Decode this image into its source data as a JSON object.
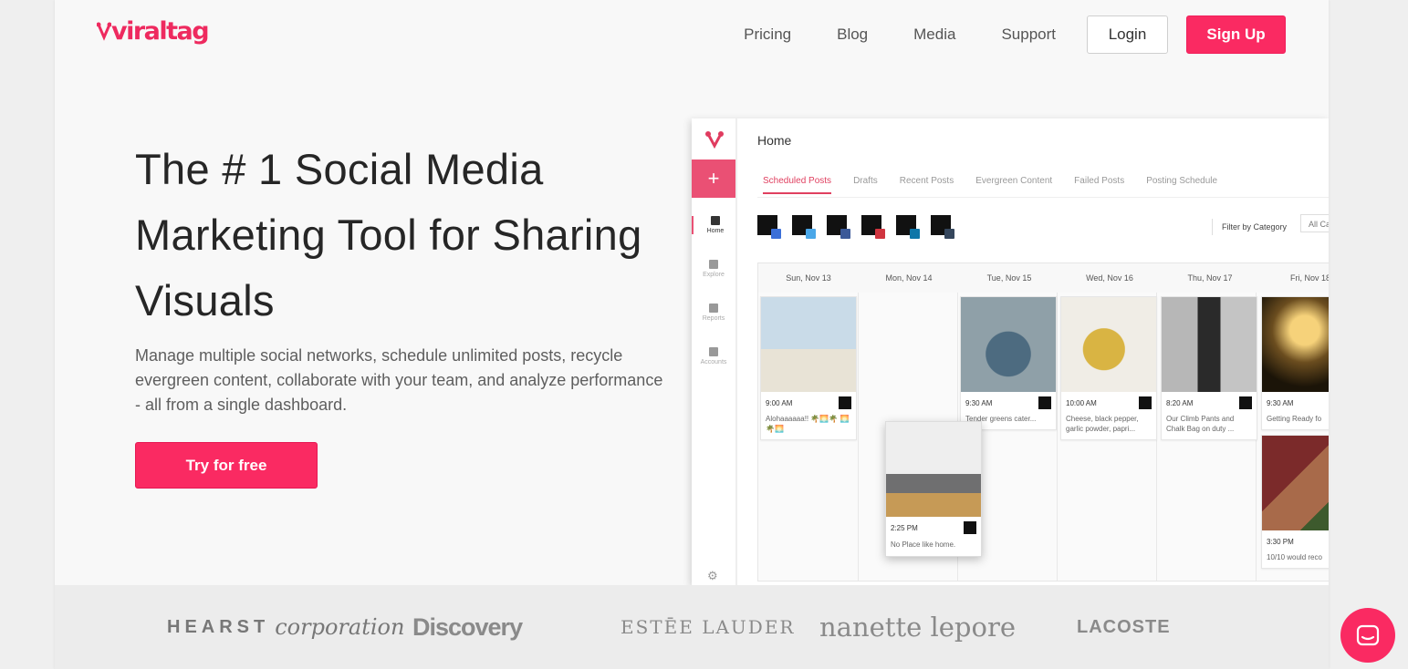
{
  "brand": {
    "logo_text": "viraltag",
    "accent": "#fa2a62"
  },
  "nav": {
    "links": [
      "Pricing",
      "Blog",
      "Media",
      "Support"
    ],
    "login_label": "Login",
    "signup_label": "Sign Up"
  },
  "hero": {
    "title": "The # 1 Social Media Marketing Tool for Sharing Visuals",
    "subtitle": "Manage multiple social networks, schedule unlimited posts, recycle evergreen content, collaborate with your team, and analyze performance - all from a single dashboard.",
    "cta_label": "Try for free"
  },
  "app": {
    "page_title": "Home",
    "add_icon": "+",
    "sidebar": [
      "Home",
      "Explore",
      "Reports",
      "Accounts"
    ],
    "tabs": [
      "Scheduled Posts",
      "Drafts",
      "Recent Posts",
      "Evergreen Content",
      "Failed Posts",
      "Posting Schedule"
    ],
    "account_networks": [
      "instagram",
      "twitter",
      "facebook",
      "pinterest",
      "linkedin",
      "tumblr"
    ],
    "filter_label": "Filter by Category",
    "filter_value": "All Ca",
    "days": [
      "Sun, Nov 13",
      "Mon, Nov 14",
      "Tue, Nov 15",
      "Wed, Nov 16",
      "Thu, Nov 17",
      "Fri, Nov 18"
    ],
    "posts": [
      {
        "time": "9:00 AM",
        "caption": "Alohaaaaaa!! 🌴🌅🌴 🌅🌴🌅"
      },
      {
        "time": "9:30 AM",
        "caption": "Tender greens cater..."
      },
      {
        "time": "10:00 AM",
        "caption": "Cheese, black pepper, garlic powder, papri..."
      },
      {
        "time": "8:20 AM",
        "caption": "Our Climb Pants and Chalk Bag on duty ..."
      },
      {
        "time": "9:30 AM",
        "caption": "Getting Ready fo"
      },
      {
        "time": "3:30 PM",
        "caption": "10/10 would reco"
      }
    ],
    "dragged_post": {
      "time": "2:25 PM",
      "caption": "No Place like home."
    }
  },
  "brands": {
    "hearst_main": "HEARST",
    "hearst_sub": "corporation",
    "discovery": "Discovery",
    "estee": "ESTĒE LAUDER",
    "nanette": "nanette lepore",
    "lacoste": "LACOSTE"
  }
}
